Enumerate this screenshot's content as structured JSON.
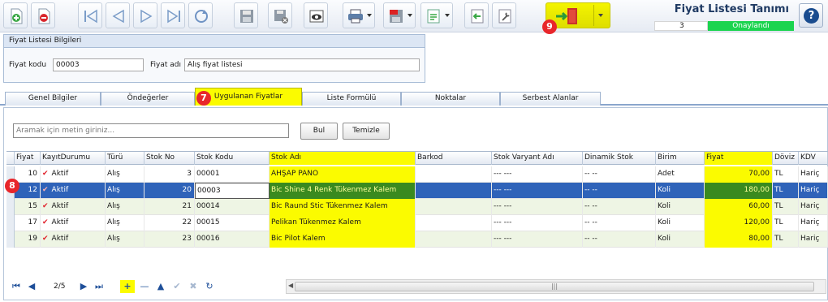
{
  "title": {
    "text": "Fiyat Listesi Tanımı",
    "status_number": "3",
    "status_value": "Onaylandı"
  },
  "toolbar": {
    "buttons": [
      {
        "name": "new-document-button",
        "icon": "new-document-icon"
      },
      {
        "name": "delete-document-button",
        "icon": "delete-document-icon"
      },
      {
        "name": "first-record-button",
        "icon": "first-record-icon"
      },
      {
        "name": "previous-record-button",
        "icon": "previous-record-icon"
      },
      {
        "name": "next-record-button",
        "icon": "next-record-icon"
      },
      {
        "name": "last-record-button",
        "icon": "last-record-icon"
      },
      {
        "name": "refresh-button",
        "icon": "refresh-icon"
      },
      {
        "name": "save-button",
        "icon": "save-icon"
      },
      {
        "name": "save-close-button",
        "icon": "save-close-icon"
      },
      {
        "name": "preview-button",
        "icon": "preview-icon"
      },
      {
        "name": "print-button",
        "icon": "print-icon"
      },
      {
        "name": "pdf-export-button",
        "icon": "pdf-icon"
      },
      {
        "name": "export-button",
        "icon": "export-icon"
      },
      {
        "name": "import-button",
        "icon": "import-icon"
      },
      {
        "name": "tools-button",
        "icon": "wrench-icon"
      },
      {
        "name": "exit-button",
        "icon": "exit-door-icon"
      }
    ]
  },
  "annotations": {
    "exit": "9",
    "tab": "7",
    "row": "8"
  },
  "info_panel": {
    "header": "Fiyat Listesi Bilgileri",
    "code_label": "Fiyat kodu",
    "code_value": "00003",
    "name_label": "Fiyat adı",
    "name_value": "Alış fiyat listesi"
  },
  "tabs": [
    "Genel Bilgiler",
    "Öndeğerler",
    "Uygulanan Fiyatlar",
    "Liste Formülü",
    "Noktalar",
    "Serbest Alanlar"
  ],
  "search": {
    "placeholder": "Aramak için metin giriniz...",
    "find_label": "Bul",
    "clear_label": "Temizle"
  },
  "grid": {
    "headers": [
      "Fiyat",
      "KayıtDurumu",
      "Türü",
      "Stok No",
      "Stok Kodu",
      "Stok Adı",
      "Barkod",
      "Stok Varyant Adı",
      "Dinamik Stok",
      "Birim",
      "Fiyat",
      "Döviz",
      "KDV"
    ],
    "rows": [
      {
        "fiyat": "10",
        "durum": "Aktif",
        "turu": "Alış",
        "stok_no": "3",
        "stok_kodu": "00001",
        "stok_adi": "AHŞAP PANO",
        "barkod": "",
        "varyant": "--- ---",
        "dinamik": "-- --",
        "birim": "Adet",
        "fiyat_tutar": "70,00",
        "doviz": "TL",
        "kdv": "Hariç"
      },
      {
        "fiyat": "12",
        "durum": "Aktif",
        "turu": "Alış",
        "stok_no": "20",
        "stok_kodu": "00003",
        "stok_adi": "Bic Shine 4 Renk Tükenmez Kalem",
        "barkod": "",
        "varyant": "--- ---",
        "dinamik": "-- --",
        "birim": "Koli",
        "fiyat_tutar": "180,00",
        "doviz": "TL",
        "kdv": "Hariç"
      },
      {
        "fiyat": "15",
        "durum": "Aktif",
        "turu": "Alış",
        "stok_no": "21",
        "stok_kodu": "00014",
        "stok_adi": "Bic Raund Stic Tükenmez Kalem",
        "barkod": "",
        "varyant": "--- ---",
        "dinamik": "-- --",
        "birim": "Koli",
        "fiyat_tutar": "60,00",
        "doviz": "TL",
        "kdv": "Hariç"
      },
      {
        "fiyat": "17",
        "durum": "Aktif",
        "turu": "Alış",
        "stok_no": "22",
        "stok_kodu": "00015",
        "stok_adi": "Pelikan Tükenmez Kalem",
        "barkod": "",
        "varyant": "--- ---",
        "dinamik": "-- --",
        "birim": "Koli",
        "fiyat_tutar": "120,00",
        "doviz": "TL",
        "kdv": "Hariç"
      },
      {
        "fiyat": "19",
        "durum": "Aktif",
        "turu": "Alış",
        "stok_no": "23",
        "stok_kodu": "00016",
        "stok_adi": "Bic Pilot Kalem",
        "barkod": "",
        "varyant": "--- ---",
        "dinamik": "-- --",
        "birim": "Koli",
        "fiyat_tutar": "80,00",
        "doviz": "TL",
        "kdv": "Hariç"
      }
    ]
  },
  "navigator": {
    "page": "2/5"
  },
  "colors": {
    "highlight": "#fbfb00",
    "selected_row": "#2f63b9",
    "status_green": "#1bd44f",
    "badge_red": "#e8262b"
  }
}
